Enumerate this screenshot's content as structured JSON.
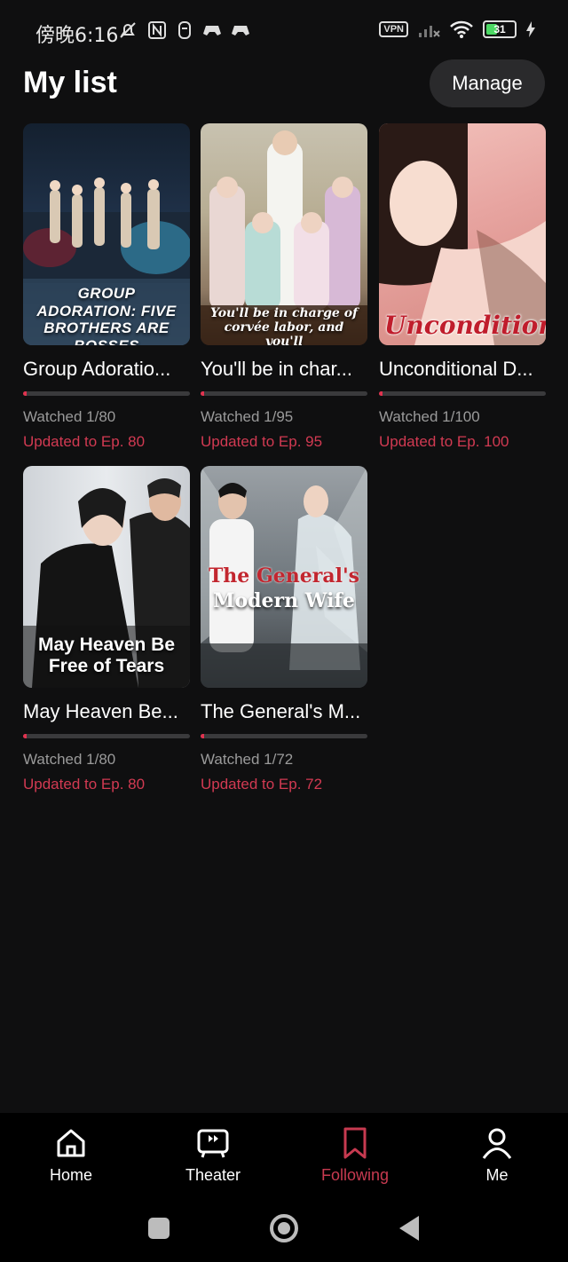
{
  "status_bar": {
    "time": "傍晚6:16",
    "vpn": "VPN",
    "battery": "31"
  },
  "header": {
    "title": "My list",
    "manage_label": "Manage"
  },
  "items": [
    {
      "title": "Group Adoratio...",
      "poster_text": "GROUP ADORATION: FIVE BROTHERS ARE BOSSES",
      "watched": "Watched 1/80",
      "updated": "Updated to Ep. 80",
      "progress": 0.0125
    },
    {
      "title": "You'll be in char...",
      "poster_text": "You'll be in charge of corvée labor, and you'll",
      "watched": "Watched 1/95",
      "updated": "Updated to Ep. 95",
      "progress": 0.0105
    },
    {
      "title": "Unconditional D...",
      "poster_text": "Unconditional",
      "watched": "Watched 1/100",
      "updated": "Updated to Ep. 100",
      "progress": 0.01
    },
    {
      "title": "May Heaven  Be...",
      "poster_text": "May Heaven Be Free of Tears",
      "watched": "Watched 1/80",
      "updated": "Updated to Ep. 80",
      "progress": 0.0125
    },
    {
      "title": "The General's M...",
      "poster_text_1": "The General's",
      "poster_text_2": "Modern Wife",
      "watched": "Watched 1/72",
      "updated": "Updated to Ep. 72",
      "progress": 0.0139
    }
  ],
  "bottom_nav": {
    "home": "Home",
    "theater": "Theater",
    "following": "Following",
    "me": "Me"
  },
  "colors": {
    "accent": "#c73a50",
    "background": "#0f0f10"
  }
}
